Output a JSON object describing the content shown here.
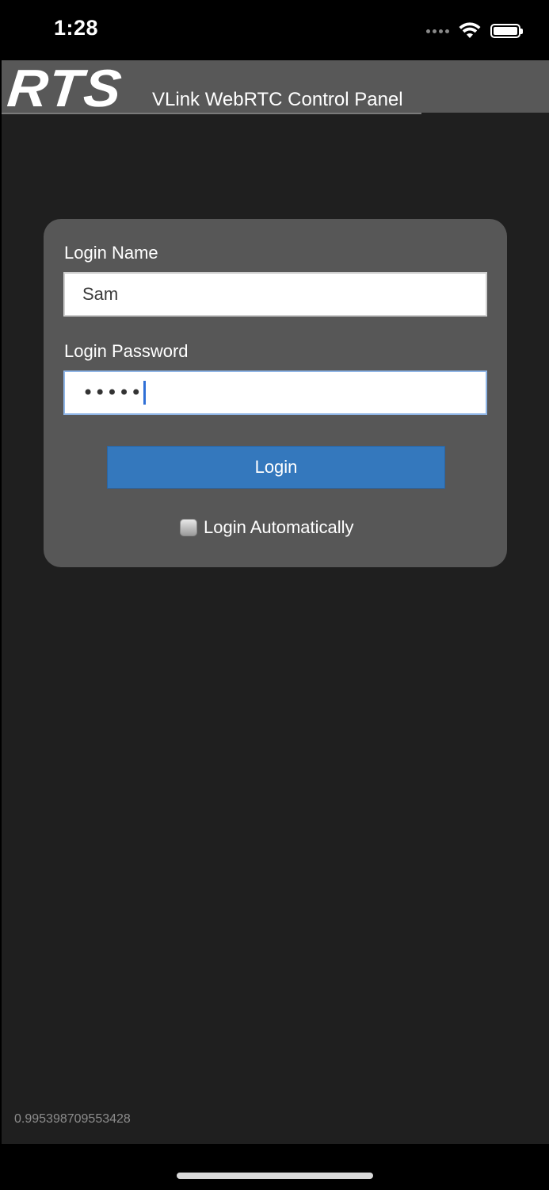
{
  "status_bar": {
    "time": "1:28",
    "icons": [
      "signal-icon",
      "wifi-icon",
      "battery-icon"
    ]
  },
  "header": {
    "logo": "RTS",
    "title": "VLink WebRTC Control Panel"
  },
  "login": {
    "name_label": "Login Name",
    "name_value": "Sam",
    "password_label": "Login Password",
    "password_value": "•••••",
    "button_label": "Login",
    "auto_login_label": "Login Automatically",
    "auto_login_checked": false
  },
  "footer": {
    "version": "0.995398709553428"
  },
  "colors": {
    "background": "#1f1f1f",
    "header": "#585858",
    "card": "#575757",
    "button": "#3478bd",
    "focus_border": "#8fb5e6"
  }
}
